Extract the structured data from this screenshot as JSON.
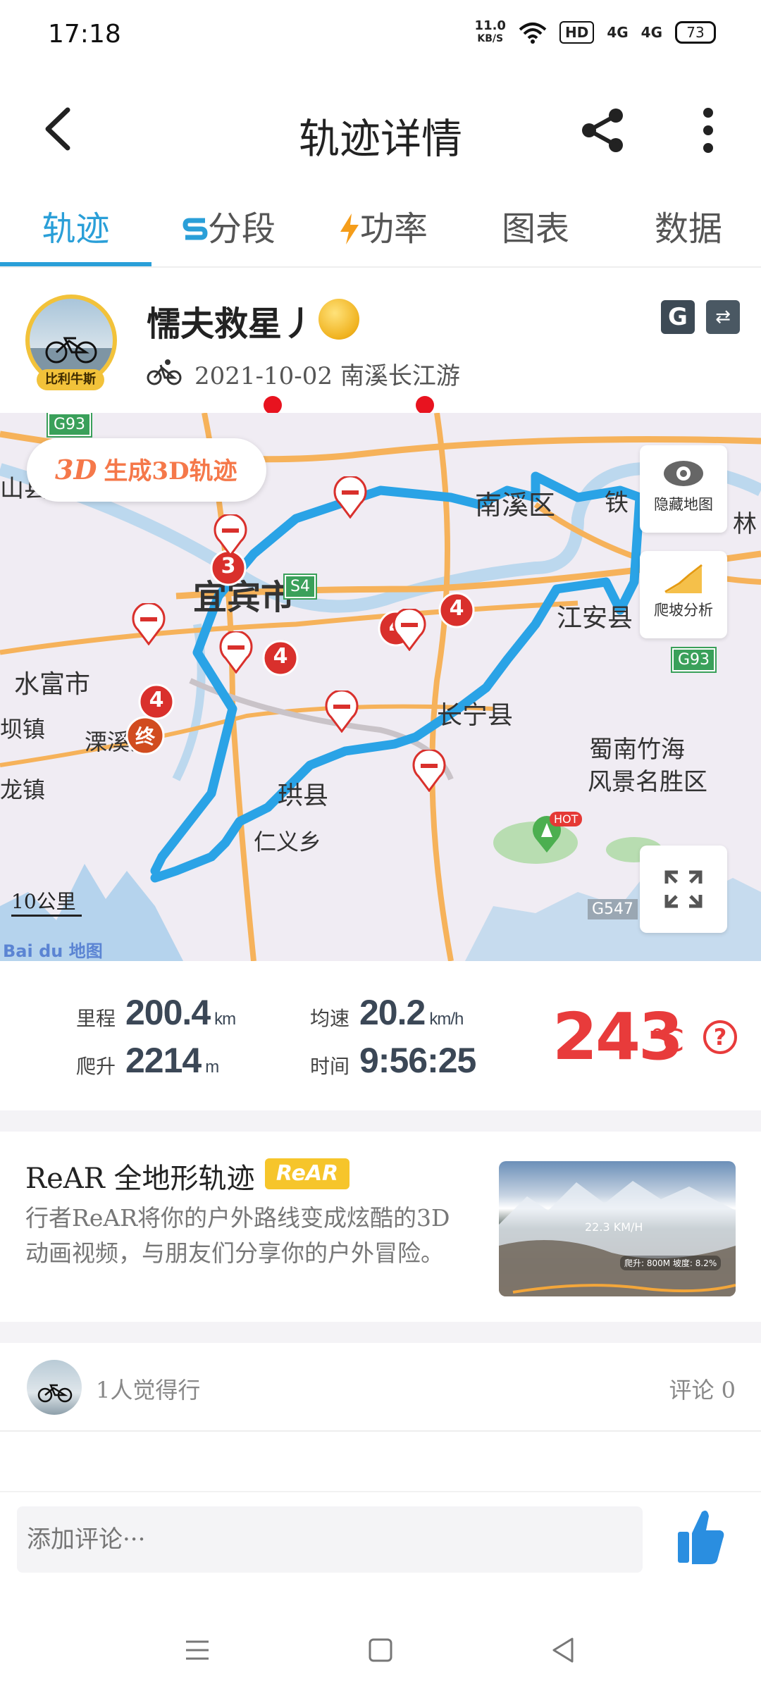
{
  "status_bar": {
    "time": "17:18",
    "net_speed_value": "11.0",
    "net_speed_unit": "KB/S",
    "hd_label": "HD",
    "signal1": "4G",
    "signal2": "4G",
    "battery": "73"
  },
  "header": {
    "title": "轨迹详情",
    "icons": [
      "back-arrow-icon",
      "share-icon",
      "more-vertical-icon"
    ]
  },
  "tabs": [
    {
      "label": "轨迹",
      "active": true
    },
    {
      "label": "分段",
      "has_dot": true
    },
    {
      "label": "功率",
      "has_dot": true
    },
    {
      "label": "图表"
    },
    {
      "label": "数据"
    }
  ],
  "user": {
    "name": "懦夫救星丿",
    "avatar_badge": "比利牛斯",
    "date": "2021-10-02",
    "ride_title": "南溪长江游",
    "meta_line": "2021-10-02 南溪长江游",
    "badge_g": "G"
  },
  "map": {
    "btn_3d_prefix": "3D",
    "btn_3d_label": "生成3D轨迹",
    "hide_map_label": "隐藏地图",
    "climb_label": "爬坡分析",
    "scale_label": "10公里",
    "watermark": "Bai du 地图",
    "labels": {
      "yibin": "宜宾市",
      "nanxi": "南溪区",
      "jiangan": "江安县",
      "changning": "长宁县",
      "shuifu": "水富市",
      "liuxi": "溧溪乡",
      "gongxian": "珙县",
      "renyi": "仁义乡",
      "zhunan": "蜀南竹海",
      "fengjing": "风景名胜区",
      "shanxian": "山县",
      "bazhen": "坝镇",
      "longzhen": "龙镇",
      "tie": "铁",
      "lin": "林"
    },
    "road_codes": [
      "G93",
      "S4",
      "G93",
      "G547"
    ],
    "markers": [
      "3",
      "4",
      "4",
      "4",
      "4",
      "终"
    ],
    "hot": "HOT"
  },
  "stats": {
    "distance_label": "里程",
    "distance_value": "200.4",
    "distance_unit": "km",
    "climb_label": "爬升",
    "climb_value": "2214",
    "climb_unit": "m",
    "speed_label": "均速",
    "speed_value": "20.2",
    "speed_unit": "km/h",
    "time_label": "时间",
    "time_value": "9:56:25",
    "big_value": "243",
    "big_unit": "℃",
    "help": "?"
  },
  "rear": {
    "title": "ReAR 全地形轨迹",
    "logo": "ReAR",
    "description": "行者ReAR将你的户外路线变成炫酷的3D动画视频，与朋友们分享你的户外冒险。",
    "img_speed": "22.3 KM/H",
    "img_stats": "爬升: 800M  坡度: 8.2%"
  },
  "social": {
    "likes": "1人觉得行",
    "comments": "评论 0"
  },
  "comment_box": {
    "placeholder": "添加评论···"
  }
}
